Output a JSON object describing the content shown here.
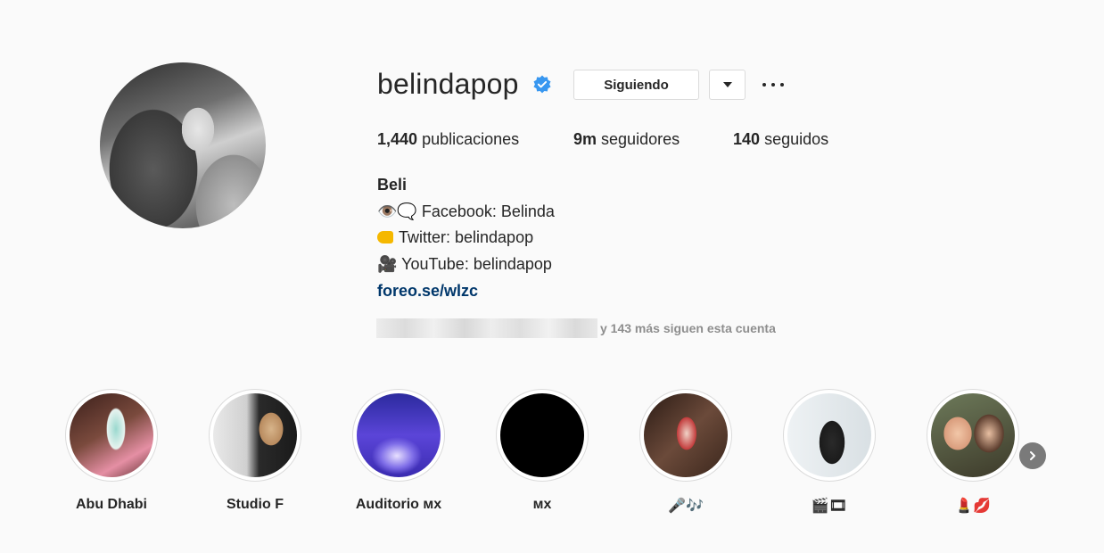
{
  "profile": {
    "username": "belindapop",
    "following_button_label": "Siguiendo",
    "stats": {
      "posts_count": "1,440",
      "posts_label": "publicaciones",
      "followers_count": "9m",
      "followers_label": "seguidores",
      "following_count": "140",
      "following_label": "seguidos"
    },
    "bio": {
      "name": "Beli",
      "line1": "👁️🗨️ Facebook: Belinda",
      "line2": "Twitter: belindapop",
      "line3": "🎥 YouTube: belindapop",
      "link": "foreo.se/wlzc"
    },
    "followed_by_text": "y 143 más siguen esta cuenta"
  },
  "highlights": [
    {
      "label": "Abu Dhabi"
    },
    {
      "label": "Studio F"
    },
    {
      "label": "Auditorio мх"
    },
    {
      "label": "мх"
    },
    {
      "label": "🎤🎶"
    },
    {
      "label": "🎬🎞"
    },
    {
      "label": "💄💋"
    }
  ],
  "icons": {
    "verified": "verified-badge-icon",
    "dropdown": "chevron-down-icon",
    "more": "more-options-icon",
    "next": "chevron-right-icon"
  },
  "colors": {
    "background": "#fafafa",
    "verified_blue": "#3897f0",
    "link": "#00376b",
    "muted": "#8e8e8e"
  }
}
